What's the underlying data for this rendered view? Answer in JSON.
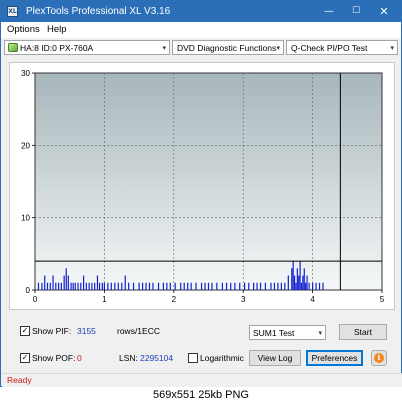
{
  "window": {
    "title": "PlexTools Professional XL V3.16",
    "icon_label": "XL",
    "controls": {
      "minimize": "—",
      "maximize": "☐",
      "close": "✕"
    }
  },
  "menu": {
    "options": "Options",
    "help": "Help"
  },
  "toolbar": {
    "drive": "HA:8 ID:0  PX-760A",
    "function": "DVD Diagnostic Functions",
    "test": "Q-Check PI/PO Test",
    "arrow": "▾"
  },
  "chart_data": {
    "type": "bar",
    "x_ticks": [
      "0",
      "1",
      "2",
      "3",
      "4",
      "5"
    ],
    "y_ticks": [
      "0",
      "10",
      "20",
      "30"
    ],
    "xlim": [
      0,
      5
    ],
    "ylim": [
      0,
      30
    ],
    "threshold": 4,
    "end_marker": 4.4,
    "colors": {
      "bars": "#1020d0",
      "threshold": "#000000",
      "bg_top": "#a7b6bb",
      "bg_bottom": "#f5f8f8",
      "grid": "#5a6468"
    },
    "x": [
      0.05,
      0.1,
      0.14,
      0.18,
      0.22,
      0.26,
      0.3,
      0.34,
      0.38,
      0.42,
      0.45,
      0.48,
      0.52,
      0.55,
      0.58,
      0.62,
      0.66,
      0.7,
      0.74,
      0.78,
      0.82,
      0.86,
      0.9,
      0.93,
      0.97,
      1.0,
      1.05,
      1.1,
      1.15,
      1.2,
      1.25,
      1.3,
      1.35,
      1.42,
      1.5,
      1.55,
      1.6,
      1.65,
      1.7,
      1.78,
      1.85,
      1.9,
      1.95,
      2.02,
      2.1,
      2.15,
      2.2,
      2.25,
      2.32,
      2.4,
      2.45,
      2.5,
      2.55,
      2.62,
      2.7,
      2.76,
      2.82,
      2.88,
      2.95,
      3.02,
      3.08,
      3.15,
      3.2,
      3.25,
      3.32,
      3.4,
      3.45,
      3.5,
      3.55,
      3.6,
      3.65,
      3.7,
      3.72,
      3.74,
      3.76,
      3.78,
      3.8,
      3.82,
      3.84,
      3.86,
      3.88,
      3.9,
      3.92,
      3.95,
      4.0,
      4.05,
      4.1,
      4.15
    ],
    "values": [
      1,
      1,
      2,
      1,
      1,
      2,
      1,
      1,
      1,
      2,
      3,
      2,
      1,
      1,
      1,
      1,
      1,
      2,
      1,
      1,
      1,
      1,
      2,
      1,
      1,
      1,
      1,
      1,
      1,
      1,
      1,
      2,
      1,
      1,
      1,
      1,
      1,
      1,
      1,
      1,
      1,
      1,
      1,
      1,
      1,
      1,
      1,
      1,
      1,
      1,
      1,
      1,
      1,
      1,
      1,
      1,
      1,
      1,
      1,
      1,
      1,
      1,
      1,
      1,
      1,
      1,
      1,
      1,
      1,
      1,
      2,
      3,
      4,
      2,
      1,
      3,
      2,
      4,
      1,
      2,
      3,
      1,
      2,
      1,
      1,
      1,
      1,
      1
    ]
  },
  "controls": {
    "show_pif_label": "Show PIF:",
    "pif_value": "3155",
    "rows_label": "rows/1ECC",
    "sum_test": "SUM1 Test",
    "start": "Start",
    "show_pof_label": "Show POF:",
    "pof_value": "0",
    "lsn_label": "LSN:",
    "lsn_value": "2295104",
    "logarithmic": "Logarithmic",
    "view_log": "View Log",
    "preferences": "Preferences",
    "check_mark": "✓",
    "info_glyph": "i"
  },
  "status": {
    "text": "Ready"
  },
  "caption": "569x551  25kb  PNG"
}
